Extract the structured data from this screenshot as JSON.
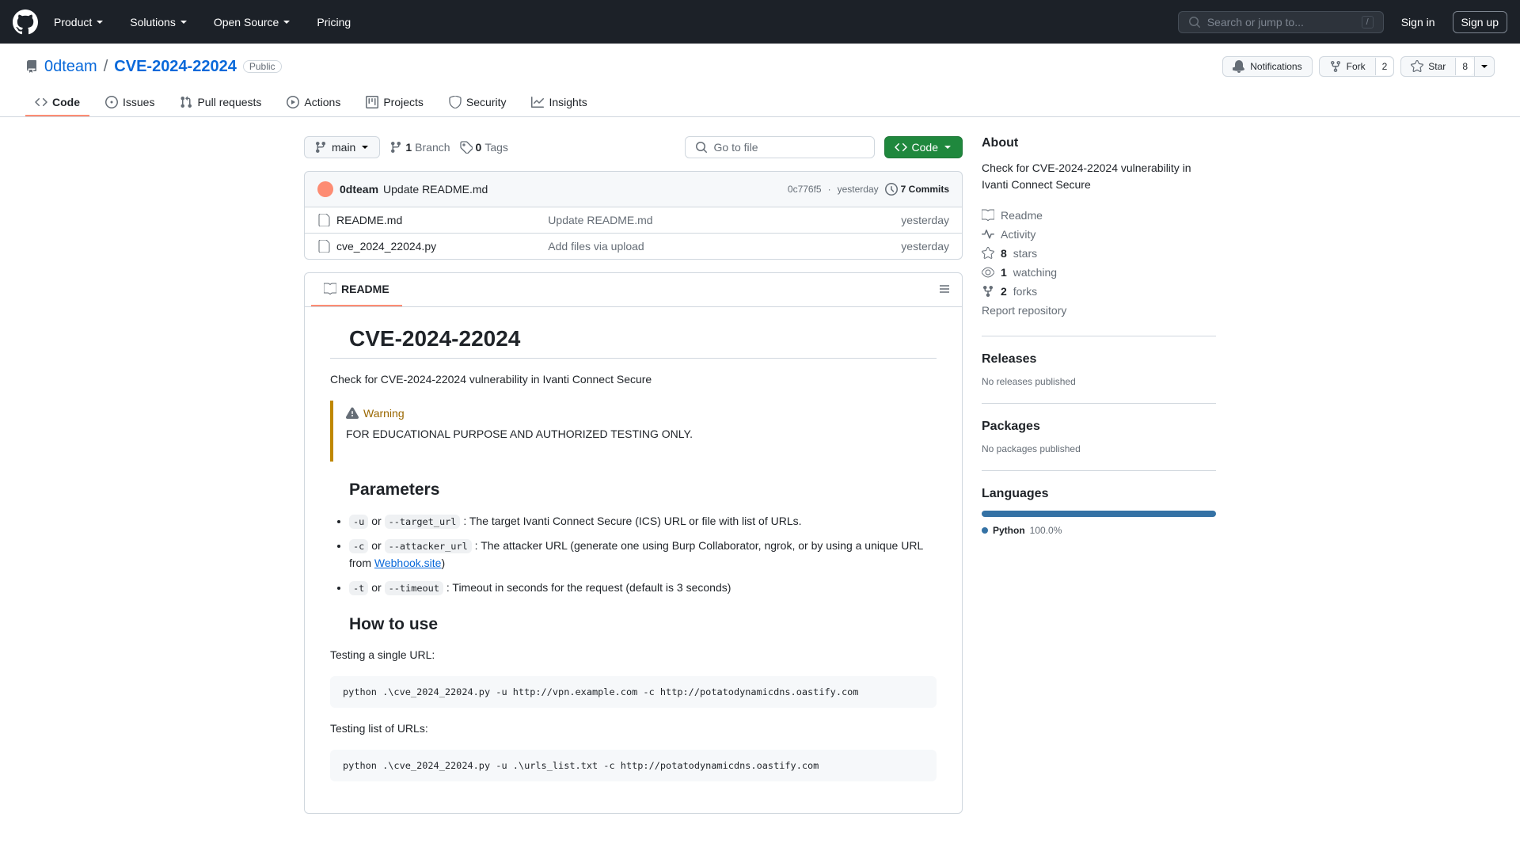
{
  "header": {
    "nav": [
      "Product",
      "Solutions",
      "Open Source",
      "Pricing"
    ],
    "search_placeholder": "Search or jump to...",
    "search_kbd": "/",
    "sign_in": "Sign in",
    "sign_up": "Sign up"
  },
  "repo": {
    "owner": "0dteam",
    "name": "CVE-2024-22024",
    "visibility": "Public",
    "notifications_label": "Notifications",
    "fork_label": "Fork",
    "fork_count": "2",
    "star_label": "Star",
    "star_count": "8"
  },
  "tabs": {
    "code": "Code",
    "issues": "Issues",
    "pulls": "Pull requests",
    "actions": "Actions",
    "projects": "Projects",
    "security": "Security",
    "insights": "Insights"
  },
  "files": {
    "branch": "main",
    "branches_count": "1",
    "branches_label": "Branch",
    "tags_count": "0",
    "tags_label": "Tags",
    "go_to_file": "Go to file",
    "code_btn": "Code",
    "latest_commit": {
      "author": "0dteam",
      "message": "Update README.md",
      "hash": "0c776f5",
      "time": "yesterday",
      "commits_count": "7 Commits"
    },
    "list": [
      {
        "name": "README.md",
        "msg": "Update README.md",
        "time": "yesterday"
      },
      {
        "name": "cve_2024_22024.py",
        "msg": "Add files via upload",
        "time": "yesterday"
      }
    ]
  },
  "readme": {
    "tab_label": "README",
    "title": "CVE-2024-22024",
    "intro": "Check for CVE-2024-22024 vulnerability in Ivanti Connect Secure",
    "warning_label": "Warning",
    "warning_text": "FOR EDUCATIONAL PURPOSE AND AUTHORIZED TESTING ONLY.",
    "params_heading": "Parameters",
    "param1_a": "-u",
    "param1_b": "--target_url",
    "param1_desc": " : The target Ivanti Connect Secure (ICS) URL or file with list of URLs.",
    "param2_a": "-c",
    "param2_b": "--attacker_url",
    "param2_desc_pre": " : The attacker URL (generate one using Burp Collaborator, ngrok, or by using a unique URL from ",
    "param2_link": "Webhook.site",
    "param2_desc_post": ")",
    "param3_a": "-t",
    "param3_b": "--timeout",
    "param3_desc": " : Timeout in seconds for the request (default is 3 seconds)",
    "or": " or ",
    "howto_heading": "How to use",
    "howto_single": "Testing a single URL:",
    "howto_single_cmd": "python .\\cve_2024_22024.py -u http://vpn.example.com -c http://potatodynamicdns.oastify.com",
    "howto_list": "Testing list of URLs:",
    "howto_list_cmd": "python .\\cve_2024_22024.py -u .\\urls_list.txt -c http://potatodynamicdns.oastify.com"
  },
  "about": {
    "heading": "About",
    "description": "Check for CVE-2024-22024 vulnerability in Ivanti Connect Secure",
    "readme": "Readme",
    "activity": "Activity",
    "stars_num": "8",
    "stars_label": " stars",
    "watching_num": "1",
    "watching_label": " watching",
    "forks_num": "2",
    "forks_label": " forks",
    "report": "Report repository"
  },
  "releases": {
    "heading": "Releases",
    "none": "No releases published"
  },
  "packages": {
    "heading": "Packages",
    "none": "No packages published"
  },
  "languages": {
    "heading": "Languages",
    "name": "Python",
    "pct": "100.0%"
  }
}
